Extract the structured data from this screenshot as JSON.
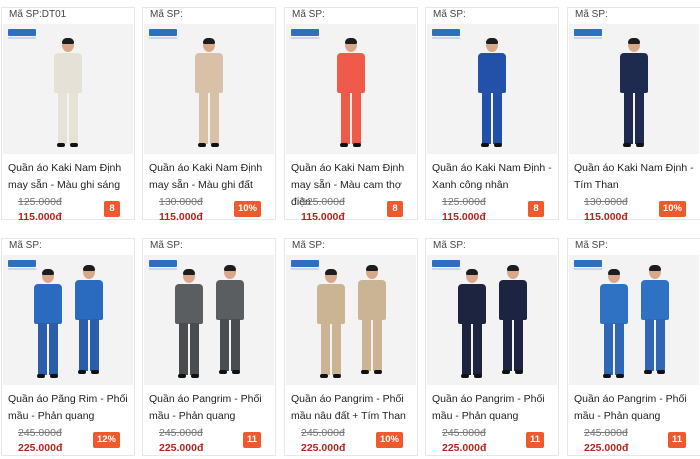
{
  "products": [
    {
      "sku": "Mã SP:DT01",
      "name": "Quần áo Kaki Nam Định may sẵn - Màu ghi sáng",
      "old_price": "125.000đ",
      "new_price": "115.000đ",
      "badge": "8",
      "top_color": "#e6e1d6",
      "bottom_color": "#e6e1d6",
      "people": 1
    },
    {
      "sku": "Mã SP:",
      "name": "Quần áo Kaki Nam Định may sẵn - Màu ghi đất",
      "old_price": "130.000đ",
      "new_price": "115.000đ",
      "badge": "10%",
      "top_color": "#d7c2a8",
      "bottom_color": "#d7c2a8",
      "people": 1
    },
    {
      "sku": "Mã SP:",
      "name": "Quần áo Kaki Nam Định may sẵn - Màu cam thợ điện",
      "old_price": "125.000đ",
      "new_price": "115.000đ",
      "badge": "8",
      "top_color": "#f05a4a",
      "bottom_color": "#f05a4a",
      "people": 1
    },
    {
      "sku": "Mã SP:",
      "name": "Quần áo Kaki Nam Định - Xanh công nhân",
      "old_price": "125.000đ",
      "new_price": "115.000đ",
      "badge": "8",
      "top_color": "#2350a8",
      "bottom_color": "#2350a8",
      "people": 1
    },
    {
      "sku": "Mã SP:",
      "name": "Quần áo Kaki Nam Định - Tím Than",
      "old_price": "130.000đ",
      "new_price": "115.000đ",
      "badge": "10%",
      "top_color": "#1e2b4e",
      "bottom_color": "#1e2b4e",
      "people": 1
    },
    {
      "sku": "Mã SP:",
      "name": "Quần áo Pãng Rim - Phối mầu - Phản quang",
      "old_price": "245.000đ",
      "new_price": "225.000đ",
      "badge": "12%",
      "top_color": "#2a6bc0",
      "bottom_color": "#2a5ea8",
      "people": 2
    },
    {
      "sku": "Mã SP:",
      "name": "Quần áo Pangrim - Phối mầu - Phản quang",
      "old_price": "245.000đ",
      "new_price": "225.000đ",
      "badge": "11",
      "top_color": "#5b5e60",
      "bottom_color": "#4a4d50",
      "people": 2
    },
    {
      "sku": "Mã SP:",
      "name": "Quần áo Pangrim - Phối mầu nâu đất + Tím Than",
      "old_price": "245.000đ",
      "new_price": "225.000đ",
      "badge": "10%",
      "top_color": "#cbb493",
      "bottom_color": "#cbb493",
      "people": 2
    },
    {
      "sku": "Mã SP:",
      "name": "Quần áo Pangrim - Phối mầu - Phản quang",
      "old_price": "245.000đ",
      "new_price": "225.000đ",
      "badge": "11",
      "top_color": "#1c2440",
      "bottom_color": "#1c2440",
      "people": 2
    },
    {
      "sku": "Mã SP:",
      "name": "Quần áo Pangrim - Phối mầu - Phản quang",
      "old_price": "245.000đ",
      "new_price": "225.000đ",
      "badge": "11",
      "top_color": "#2f72c4",
      "bottom_color": "#2f66b6",
      "people": 2
    }
  ]
}
